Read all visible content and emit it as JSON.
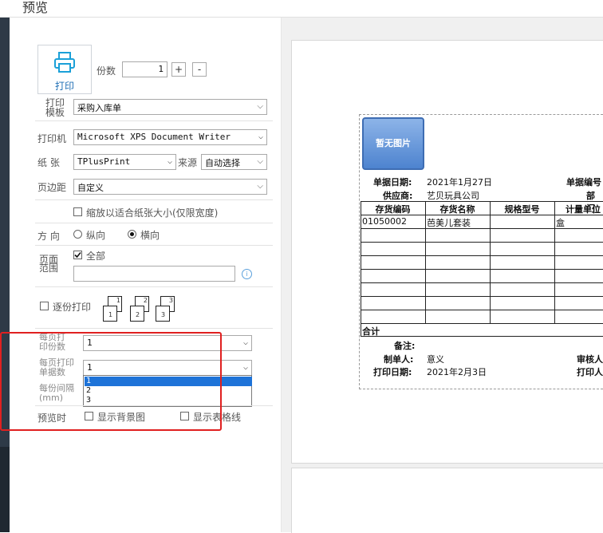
{
  "window": {
    "title": "预览"
  },
  "print": {
    "label": "打印",
    "copies_label": "份数",
    "copies_value": "1",
    "plus": "+",
    "minus": "-"
  },
  "template": {
    "label": "打印模板",
    "value": "采购入库单"
  },
  "printer": {
    "label": "打印机",
    "value": "Microsoft XPS Document Writer"
  },
  "paper": {
    "label": "纸  张",
    "value": "TPlusPrint",
    "source_label": "来源",
    "source_value": "自动选择"
  },
  "margin": {
    "label": "页边距",
    "value": "自定义"
  },
  "fit": {
    "label": "缩放以适合纸张大小(仅限宽度)",
    "checked": false
  },
  "orientation": {
    "label": "方  向",
    "portrait": "纵向",
    "landscape": "横向",
    "selected": "landscape"
  },
  "range": {
    "label": "页面范围",
    "all_label": "全部",
    "all_checked": true,
    "value": ""
  },
  "collate": {
    "label": "逐份打印",
    "checked": false,
    "pages": [
      "1",
      "1",
      "2",
      "2",
      "3",
      "3"
    ]
  },
  "per_page_copies": {
    "label": "每页打印份数",
    "value": "1"
  },
  "per_page_docs": {
    "label": "每页打印单据数",
    "value": "1",
    "options": [
      "1",
      "2",
      "3"
    ],
    "selected_index": 0
  },
  "interval": {
    "label": "每份间隔(mm)"
  },
  "preview_opts": {
    "label": "预览时",
    "show_bg": "显示背景图",
    "show_grid": "显示表格线"
  },
  "doc": {
    "no_image": "暂无图片",
    "date_label": "单据日期:",
    "date_value": "2021年1月27日",
    "docno_label": "单据编号",
    "supplier_label": "供应商:",
    "supplier_value": "艺贝玩具公司",
    "dept_label": "部门",
    "columns": [
      "存货编码",
      "存货名称",
      "规格型号",
      "计量单位"
    ],
    "row": [
      "01050002",
      "芭美儿套装",
      "",
      "盒"
    ],
    "total_label": "合计",
    "remark_label": "备注:",
    "maker_label": "制单人:",
    "maker_value": "意义",
    "reviewer_label": "审核人",
    "print_date_label": "打印日期:",
    "print_date_value": "2021年2月3日",
    "printer_label": "打印人"
  }
}
